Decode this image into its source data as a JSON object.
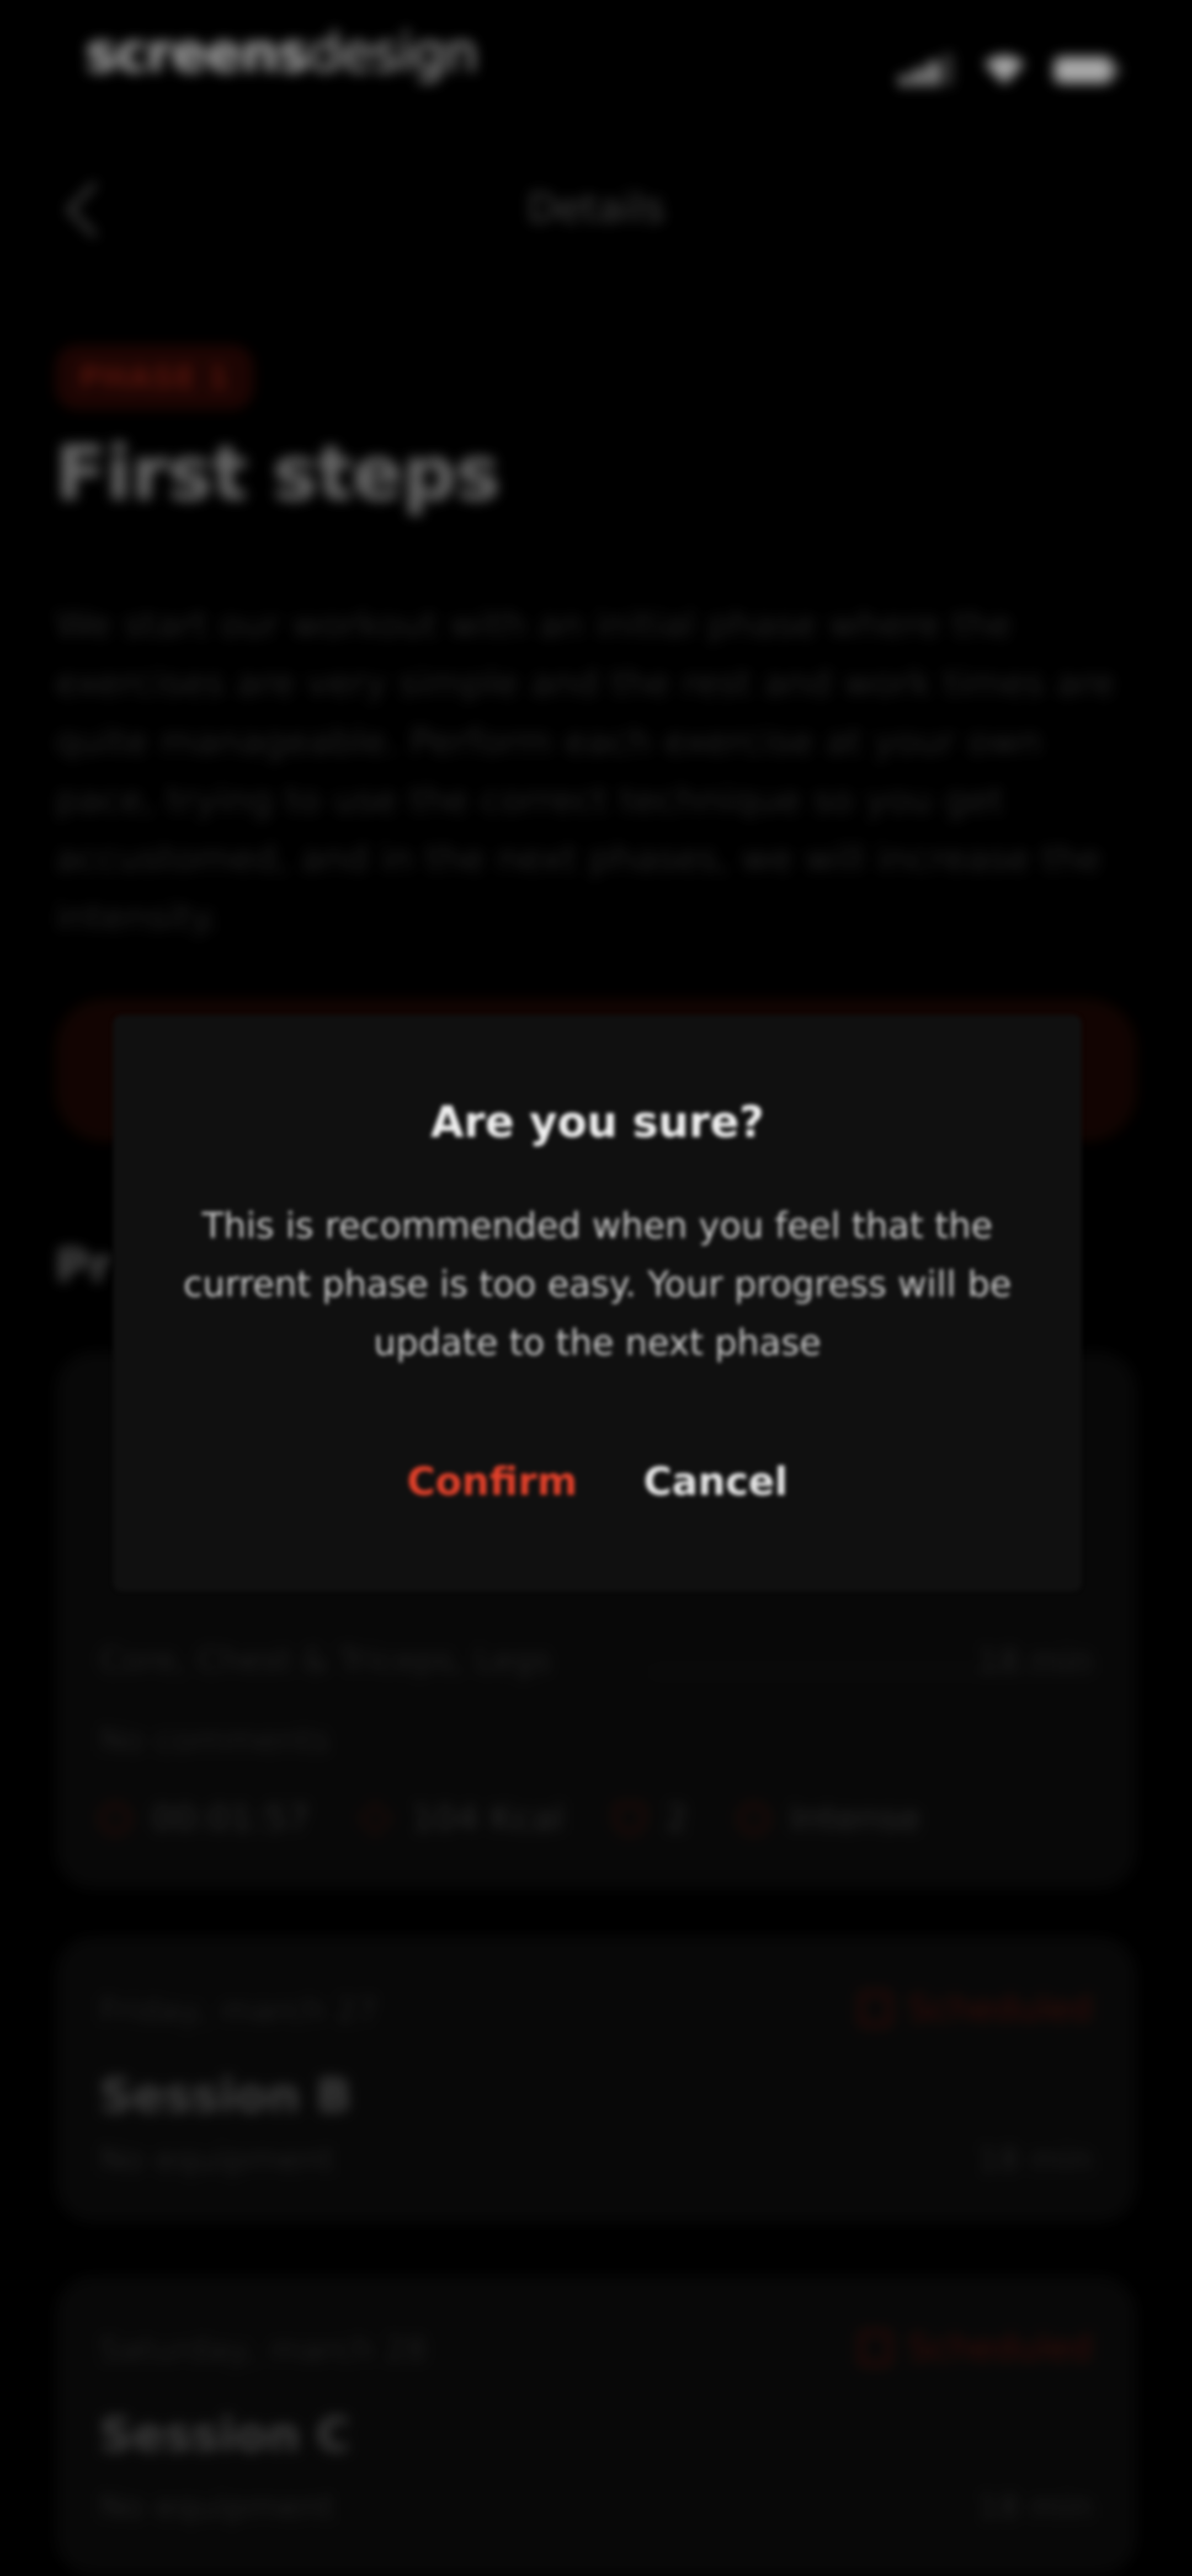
{
  "status_bar": {
    "brand_bold": "screens",
    "brand_light": "design"
  },
  "header": {
    "title": "Details",
    "back_icon": "chevron-left-icon"
  },
  "phase": {
    "badge": "PHASE 1",
    "title": "First steps",
    "description": "We start our workout with an initial phase where the exercises are very simple and the rest and work times are quite manageable. Perform each exercise at your own pace, trying to use the correct technique so you get accustomed, and in the next phases, we will increase the intensity."
  },
  "section": {
    "title": "Pr"
  },
  "sessions": [
    {
      "date": "",
      "name": "",
      "muscles": "Core, Chest & Triceps, Legs",
      "duration": "18 min",
      "comments": "No comments",
      "stats": [
        {
          "icon": "clock-icon",
          "value": "00:01:57"
        },
        {
          "icon": "bolt-icon",
          "value": "104 Kcal"
        },
        {
          "icon": "shield-icon",
          "value": "2"
        },
        {
          "icon": "flame-icon",
          "value": "Intense"
        }
      ]
    },
    {
      "date": "Friday, march 27",
      "status": "Scheduled",
      "status_icon": "calendar-icon",
      "name": "Session B",
      "equipment": "No equipment",
      "duration": "18 min"
    },
    {
      "date": "Saturday, march 28",
      "status": "Scheduled",
      "status_icon": "calendar-icon",
      "name": "Session C",
      "equipment": "No equipment",
      "duration": "18 min"
    }
  ],
  "dialog": {
    "title": "Are you sure?",
    "body": "This is recommended when you feel that the current phase is too easy. Your progress will be update to the next phase",
    "confirm_label": "Confirm",
    "cancel_label": "Cancel"
  },
  "colors": {
    "accent": "#e0402a",
    "background": "#000000",
    "dialog_bg": "#101010"
  }
}
